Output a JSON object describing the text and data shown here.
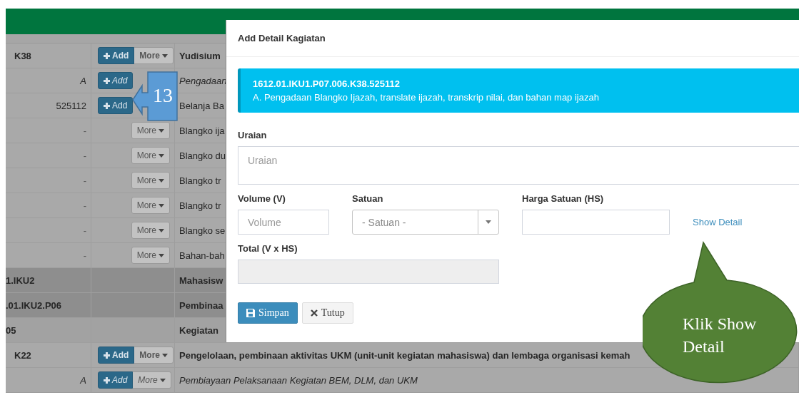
{
  "table": {
    "rows": [
      {
        "kind": "activity",
        "code": "K38",
        "buttons": [
          {
            "kind": "add",
            "label": "Add"
          },
          {
            "kind": "more",
            "label": "More"
          }
        ],
        "description": "Yudisium"
      },
      {
        "kind": "sub",
        "code": "A",
        "buttons": [
          {
            "kind": "add",
            "label": "Add"
          }
        ],
        "description": "Pengadaan"
      },
      {
        "kind": "account",
        "code": "525112",
        "buttons": [
          {
            "kind": "add",
            "label": "Add"
          }
        ],
        "description": "Belanja Ba"
      },
      {
        "kind": "detail",
        "code": "-",
        "buttons": [
          {
            "kind": "more",
            "label": "More"
          }
        ],
        "description": "Blangko ija"
      },
      {
        "kind": "detail",
        "code": "-",
        "buttons": [
          {
            "kind": "more",
            "label": "More"
          }
        ],
        "description": "Blangko du"
      },
      {
        "kind": "detail",
        "code": "-",
        "buttons": [
          {
            "kind": "more",
            "label": "More"
          }
        ],
        "description": "Blangko tr"
      },
      {
        "kind": "detail",
        "code": "-",
        "buttons": [
          {
            "kind": "more",
            "label": "More"
          }
        ],
        "description": "Blangko tr"
      },
      {
        "kind": "detail",
        "code": "-",
        "buttons": [
          {
            "kind": "more",
            "label": "More"
          }
        ],
        "description": "Blangko se"
      },
      {
        "kind": "detail",
        "code": "-",
        "buttons": [
          {
            "kind": "more",
            "label": "More"
          }
        ],
        "description": "Bahan-bah"
      },
      {
        "kind": "indicator",
        "code": "1.IKU2",
        "buttons": [],
        "description": "Mahasisw"
      },
      {
        "kind": "indicator",
        "code": ".01.IKU2.P06",
        "buttons": [],
        "description": "Pembinaa"
      },
      {
        "kind": "program",
        "code": "05",
        "buttons": [],
        "description": "Kegiatan"
      },
      {
        "kind": "activity",
        "code": "K22",
        "buttons": [
          {
            "kind": "add",
            "label": "Add"
          },
          {
            "kind": "more",
            "label": "More"
          }
        ],
        "description": "Pengelolaan, pembinaan aktivitas UKM (unit-unit kegiatan mahasiswa) dan lembaga organisasi kemah"
      },
      {
        "kind": "sub",
        "code": "A",
        "buttons": [
          {
            "kind": "add",
            "label": "Add"
          },
          {
            "kind": "more",
            "label": "More"
          }
        ],
        "description": "Pembiayaan Pelaksanaan Kegiatan BEM, DLM, dan UKM"
      }
    ]
  },
  "modal": {
    "title": "Add Detail Kagiatan",
    "info": {
      "code": "1612.01.IKU1.P07.006.K38.525112",
      "text": "A. Pengadaan Blangko Ijazah, translate ijazah, transkrip nilai, dan bahan map ijazah"
    },
    "fields": [
      {
        "kind": "textarea",
        "label": "Uraian",
        "placeholder": "Uraian"
      },
      {
        "kind": "input",
        "label": "Volume (V)",
        "placeholder": "Volume"
      },
      {
        "kind": "select",
        "label": "Satuan",
        "placeholder": "- Satuan -"
      },
      {
        "kind": "input",
        "label": "Harga Satuan (HS)"
      },
      {
        "kind": "link",
        "label": "Show Detail"
      },
      {
        "kind": "readonly",
        "label": "Total (V x HS)"
      }
    ],
    "buttons": [
      {
        "kind": "primary",
        "label": "Simpan"
      },
      {
        "kind": "default",
        "label": "Tutup"
      }
    ]
  },
  "annotations": [
    {
      "kind": "step_arrow",
      "text": "13"
    },
    {
      "kind": "speech_bubble",
      "text": "Klik Show Detail"
    }
  ]
}
